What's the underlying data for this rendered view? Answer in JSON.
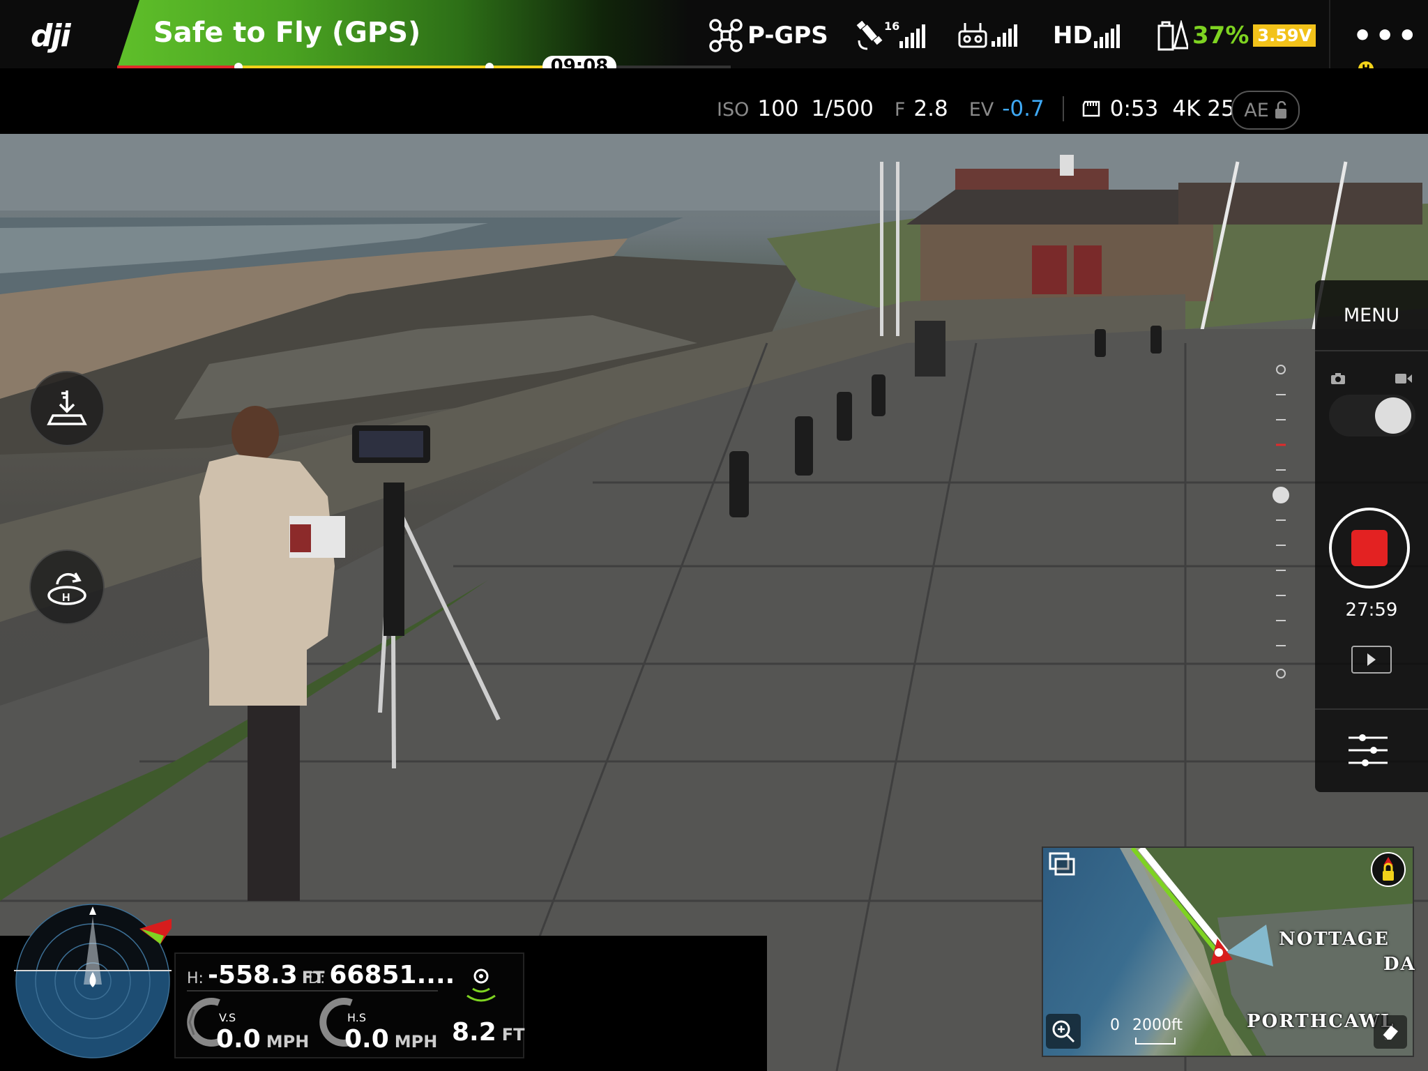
{
  "app": {
    "brand": "dji"
  },
  "status": {
    "text": "Safe to Fly (GPS)",
    "flight_time_remaining": "09:08",
    "battery_level_fraction": 0.35
  },
  "indicators": {
    "flight_mode": "P-GPS",
    "satellites": "16",
    "remote_signal_icon": "remote-controller-signal-icon",
    "video_link": "HD",
    "battery_percent": "37%",
    "battery_voltage": "3.59V",
    "more": "•••",
    "home_badge": "H",
    "colors": {
      "status_green": "#5fbf2a",
      "battery_green": "#7ed321",
      "voltage_yellow": "#f2c21a",
      "ev_blue": "#3fa9f5"
    }
  },
  "camera": {
    "iso_label": "ISO",
    "iso_value": "100",
    "shutter": "1/500",
    "aperture_label": "F",
    "aperture_value": "2.8",
    "ev_label": "EV",
    "ev_value": "-0.7",
    "rec_remaining": "0:53",
    "resolution_fps": "4K 25",
    "ae_label": "AE"
  },
  "right_panel": {
    "menu_label": "MENU",
    "record_time": "27:59",
    "mode": "video"
  },
  "telemetry": {
    "height_label": "H:",
    "height_value": "-558.3",
    "height_unit": "FT",
    "distance_label": "D:",
    "distance_value": "66851....",
    "vs_label": "V.S",
    "vs_value": "0.0",
    "vs_unit": "MPH",
    "hs_label": "H.S",
    "hs_value": "0.0",
    "hs_unit": "MPH",
    "vps_value": "8.2",
    "vps_unit": "FT"
  },
  "map": {
    "place_1": "NOTTAGE",
    "place_2": "DA",
    "place_3": "PORTHCAWL",
    "scale_start": "0",
    "scale_end": "2000ft"
  }
}
